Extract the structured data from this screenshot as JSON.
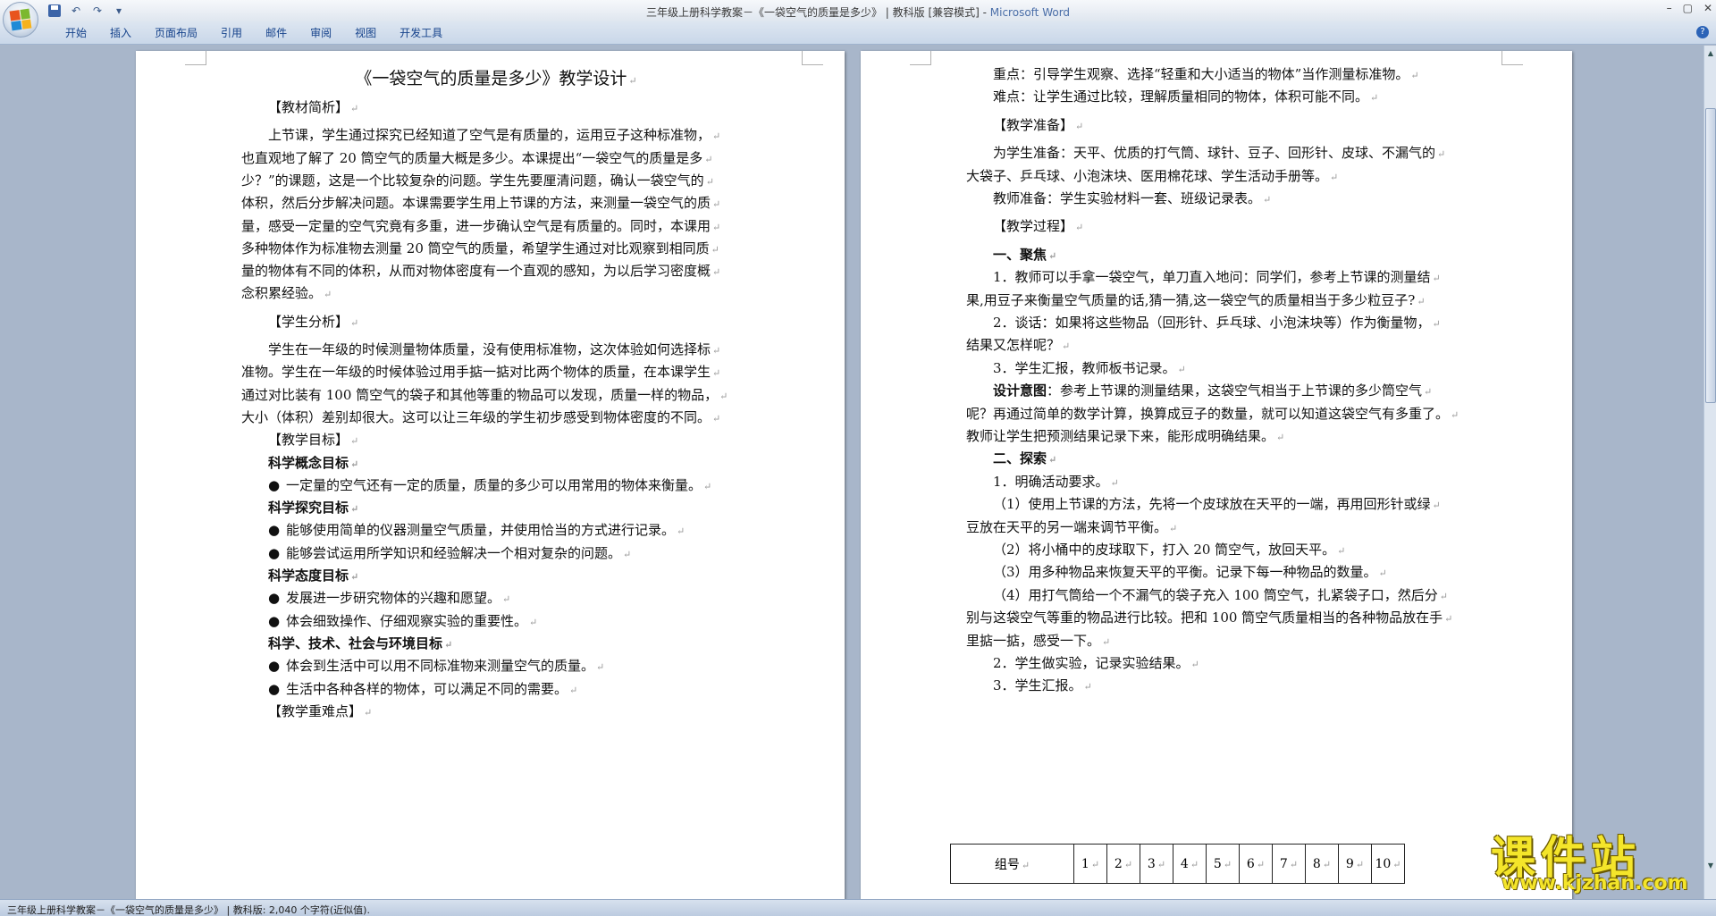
{
  "window": {
    "title_main": "三年级上册科学教案－《一袋空气的质量是多少》 | 教科版 [兼容模式] - ",
    "title_brand": "Microsoft Word"
  },
  "ribbon": {
    "tabs": [
      "开始",
      "插入",
      "页面布局",
      "引用",
      "邮件",
      "审阅",
      "视图",
      "开发工具"
    ]
  },
  "left_page": {
    "title": "《一袋空气的质量是多少》教学设计",
    "lines": [
      {
        "text": "【教材简析】",
        "indent": 1
      },
      {
        "text": "上节课，学生通过探究已经知道了空气是有质量的，运用豆子这种标准物，",
        "indent": 1
      },
      {
        "text": "也直观地了解了 20 筒空气的质量大概是多少。本课提出“一袋空气的质量是多",
        "indent": 0
      },
      {
        "text": "少？”的课题，这是一个比较复杂的问题。学生先要厘清问题，确认一袋空气的",
        "indent": 0
      },
      {
        "text": "体积，然后分步解决问题。本课需要学生用上节课的方法，来测量一袋空气的质",
        "indent": 0
      },
      {
        "text": "量，感受一定量的空气究竟有多重，进一步确认空气是有质量的。同时，本课用",
        "indent": 0
      },
      {
        "text": "多种物体作为标准物去测量 20 筒空气的质量，希望学生通过对比观察到相同质",
        "indent": 0
      },
      {
        "text": "量的物体有不同的体积，从而对物体密度有一个直观的感知，为以后学习密度概",
        "indent": 0
      },
      {
        "text": "念积累经验。",
        "indent": 0
      },
      {
        "text": "【学生分析】",
        "indent": 1
      },
      {
        "text": "学生在一年级的时候测量物体质量，没有使用标准物，这次体验如何选择标",
        "indent": 1
      },
      {
        "text": "准物。学生在一年级的时候体验过用手掂一掂对比两个物体的质量，在本课学生",
        "indent": 0
      },
      {
        "text": "通过对比装有 100 筒空气的袋子和其他等重的物品可以发现，质量一样的物品，",
        "indent": 0
      },
      {
        "text": "大小（体积）差别却很大。这可以让三年级的学生初步感受到物体密度的不同。",
        "indent": 0
      },
      {
        "text": "【教学目标】",
        "indent": 1
      },
      {
        "text": "科学概念目标",
        "indent": 1,
        "bold": true
      },
      {
        "text": "一定量的空气还有一定的质量，质量的多少可以用常用的物体来衡量。",
        "indent": 1,
        "bullet": true
      },
      {
        "text": "科学探究目标",
        "indent": 1,
        "bold": true
      },
      {
        "text": "能够使用简单的仪器测量空气质量，并使用恰当的方式进行记录。",
        "indent": 1,
        "bullet": true
      },
      {
        "text": "能够尝试运用所学知识和经验解决一个相对复杂的问题。",
        "indent": 1,
        "bullet": true
      },
      {
        "text": "科学态度目标",
        "indent": 1,
        "bold": true
      },
      {
        "text": "发展进一步研究物体的兴趣和愿望。",
        "indent": 1,
        "bullet": true
      },
      {
        "text": "体会细致操作、仔细观察实验的重要性。",
        "indent": 1,
        "bullet": true
      },
      {
        "text": "科学、技术、社会与环境目标",
        "indent": 1,
        "bold": true
      },
      {
        "text": "体会到生活中可以用不同标准物来测量空气的质量。",
        "indent": 1,
        "bullet": true
      },
      {
        "text": "生活中各种各样的物体，可以满足不同的需要。",
        "indent": 1,
        "bullet": true
      },
      {
        "text": "【教学重难点】",
        "indent": 1
      }
    ]
  },
  "right_page": {
    "lines": [
      {
        "text": "重点：引导学生观察、选择“轻重和大小适当的物体”当作测量标准物。",
        "indent": 1
      },
      {
        "text": "难点：让学生通过比较，理解质量相同的物体，体积可能不同。",
        "indent": 1
      },
      {
        "text": "【教学准备】",
        "indent": 1
      },
      {
        "text": "为学生准备：天平、优质的打气筒、球针、豆子、回形针、皮球、不漏气的",
        "indent": 1
      },
      {
        "text": "大袋子、乒乓球、小泡沫块、医用棉花球、学生活动手册等。",
        "indent": 0
      },
      {
        "text": "教师准备：学生实验材料一套、班级记录表。",
        "indent": 1
      },
      {
        "text": "【教学过程】",
        "indent": 1
      },
      {
        "text": "一、聚焦",
        "indent": 1,
        "bold": true
      },
      {
        "text": "1．教师可以手拿一袋空气，单刀直入地问：同学们，参考上节课的测量结",
        "indent": 1
      },
      {
        "text": "果,用豆子来衡量空气质量的话,猜一猜,这一袋空气的质量相当于多少粒豆子?",
        "indent": 0
      },
      {
        "text": "2．谈话：如果将这些物品（回形针、乒乓球、小泡沫块等）作为衡量物，",
        "indent": 1
      },
      {
        "text": "结果又怎样呢？",
        "indent": 0
      },
      {
        "text": "3．学生汇报，教师板书记录。",
        "indent": 1
      },
      {
        "text": "设计意图：参考上节课的测量结果，这袋空气相当于上节课的多少筒空气",
        "indent": 1,
        "lead_bold": "设计意图"
      },
      {
        "text": "呢？再通过简单的数学计算，换算成豆子的数量，就可以知道这袋空气有多重了。",
        "indent": 0
      },
      {
        "text": "教师让学生把预测结果记录下来，能形成明确结果。",
        "indent": 0
      },
      {
        "text": "二、探索",
        "indent": 1,
        "bold": true
      },
      {
        "text": "1．明确活动要求。",
        "indent": 1
      },
      {
        "text": "（1）使用上节课的方法，先将一个皮球放在天平的一端，再用回形针或绿",
        "indent": 1
      },
      {
        "text": "豆放在天平的另一端来调节平衡。",
        "indent": 0
      },
      {
        "text": "（2）将小桶中的皮球取下，打入 20 筒空气，放回天平。",
        "indent": 1
      },
      {
        "text": "（3）用多种物品来恢复天平的平衡。记录下每一种物品的数量。",
        "indent": 1
      },
      {
        "text": "（4）用打气筒给一个不漏气的袋子充入 100 筒空气，扎紧袋子口，然后分",
        "indent": 1
      },
      {
        "text": "别与这袋空气等重的物品进行比较。把和 100 筒空气质量相当的各种物品放在手",
        "indent": 0
      },
      {
        "text": "里掂一掂，感受一下。",
        "indent": 0
      },
      {
        "text": "2．学生做实验，记录实验结果。",
        "indent": 1
      },
      {
        "text": "3．学生汇报。",
        "indent": 1
      }
    ],
    "table": {
      "header": "组号",
      "columns": [
        "1",
        "2",
        "3",
        "4",
        "5",
        "6",
        "7",
        "8",
        "9",
        "10"
      ]
    }
  },
  "watermark": {
    "main": "课件站",
    "url": "www.kjzhan.com"
  },
  "status": {
    "text": "三年级上册科学教案－《一袋空气的质量是多少》 | 教科版: 2,040 个字符(近似值)."
  },
  "colors": {
    "workspace": "#a8b6ca",
    "ribbon_tab_text": "#15428b",
    "brand": "#4a6ea8",
    "watermark_fill": "#f4e52a"
  }
}
